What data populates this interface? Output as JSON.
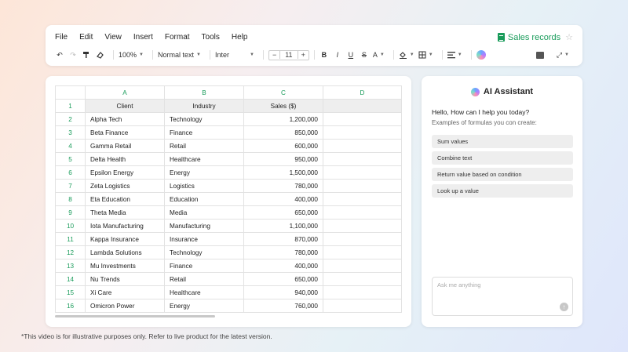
{
  "menu": [
    "File",
    "Edit",
    "View",
    "Insert",
    "Format",
    "Tools",
    "Help"
  ],
  "doc": {
    "title": "Sales records"
  },
  "toolbar": {
    "zoom": "100%",
    "style": "Normal text",
    "font": "Inter",
    "minus": "−",
    "size": "11",
    "plus": "+",
    "bold": "B",
    "italic": "I",
    "underline": "U",
    "strike": "S",
    "text_color": "A"
  },
  "sheet": {
    "columns": [
      "A",
      "B",
      "C",
      "D"
    ],
    "row_numbers": [
      "1",
      "2",
      "3",
      "4",
      "5",
      "6",
      "7",
      "8",
      "9",
      "10",
      "11",
      "12",
      "13",
      "14",
      "15",
      "16"
    ],
    "headers": [
      "Client",
      "Industry",
      "Sales ($)"
    ],
    "rows": [
      [
        "Alpha Tech",
        "Technology",
        "1,200,000"
      ],
      [
        "Beta Finance",
        "Finance",
        "850,000"
      ],
      [
        "Gamma Retail",
        "Retail",
        "600,000"
      ],
      [
        "Delta Health",
        "Healthcare",
        "950,000"
      ],
      [
        "Epsilon Energy",
        "Energy",
        "1,500,000"
      ],
      [
        "Zeta Logistics",
        "Logistics",
        "780,000"
      ],
      [
        "Eta Education",
        "Education",
        "400,000"
      ],
      [
        "Theta Media",
        "Media",
        "650,000"
      ],
      [
        "Iota Manufacturing",
        "Manufacturing",
        "1,100,000"
      ],
      [
        "Kappa Insurance",
        "Insurance",
        "870,000"
      ],
      [
        "Lambda Solutions",
        "Technology",
        "780,000"
      ],
      [
        "Mu Investments",
        "Finance",
        "400,000"
      ],
      [
        "Nu Trends",
        "Retail",
        "650,000"
      ],
      [
        "Xi Care",
        "Healthcare",
        "940,000"
      ],
      [
        "Omicron Power",
        "Energy",
        "760,000"
      ]
    ]
  },
  "assistant": {
    "title": "AI Assistant",
    "greeting": "Hello, How can I help you today?",
    "subtitle": "Examples of formulas you con create:",
    "chips": [
      "Sum values",
      "Combine text",
      "Return value based on condition",
      "Look up a value"
    ],
    "input_placeholder": "Ask me anything"
  },
  "footnote": "*This video is for illustrative purposes only. Refer to live product for the latest version.",
  "colors": {
    "accent": "#1a9c5b",
    "header_bg": "#eeeeee"
  }
}
